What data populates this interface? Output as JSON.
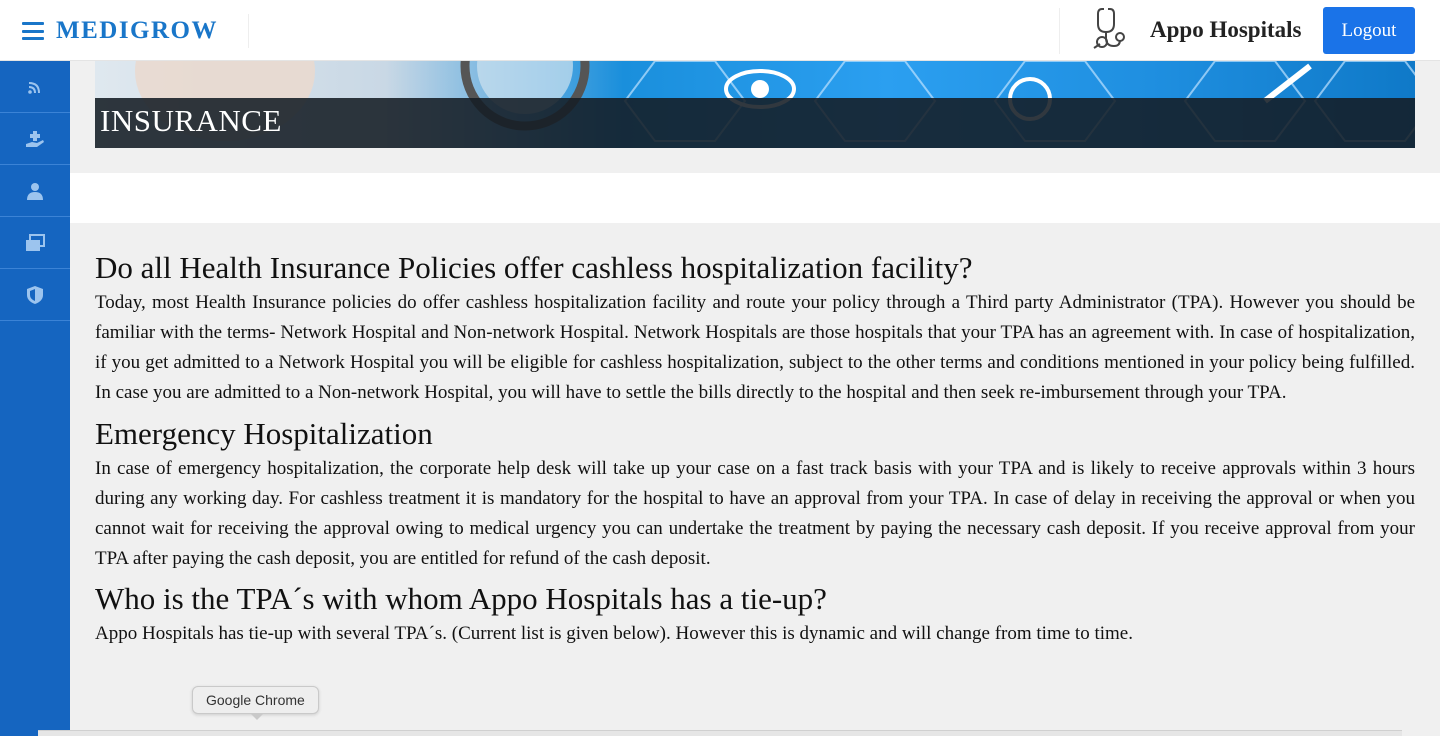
{
  "header": {
    "brand": "MEDIGROW",
    "hospital_name": "Appo Hospitals",
    "logout_label": "Logout"
  },
  "sidebar": {
    "items": [
      {
        "icon": "rss-feed-icon"
      },
      {
        "icon": "donate-hand-icon"
      },
      {
        "icon": "doctor-icon"
      },
      {
        "icon": "gallery-icon"
      },
      {
        "icon": "shield-icon"
      }
    ]
  },
  "banner": {
    "title": "INSURANCE"
  },
  "sections": [
    {
      "heading": "Do all Health Insurance Policies offer cashless hospitalization facility?",
      "body": "Today, most Health Insurance policies do offer cashless hospitalization facility and route your policy through a Third party Administrator (TPA). However you should be familiar with the terms- Network Hospital and Non-network Hospital. Network Hospitals are those hospitals that your TPA has an agreement with. In case of hospitalization, if you get admitted to a Network Hospital you will be eligible for cashless hospitalization, subject to the other terms and conditions mentioned in your policy being fulfilled. In case you are admitted to a Non-network Hospital, you will have to settle the bills directly to the hospital and then seek re-imbursement through your TPA."
    },
    {
      "heading": "Emergency Hospitalization",
      "body": "In case of emergency hospitalization, the corporate help desk will take up your case on a fast track basis with your TPA and is likely to receive approvals within 3 hours during any working day. For cashless treatment it is mandatory for the hospital to have an approval from your TPA. In case of delay in receiving the approval or when you cannot wait for receiving the approval owing to medical urgency you can undertake the treatment by paying the necessary cash deposit. If you receive approval from your TPA after paying the cash deposit, you are entitled for refund of the cash deposit."
    },
    {
      "heading": "Who is the TPA´s with whom Appo Hospitals has a tie-up?",
      "body": "Appo Hospitals has tie-up with several TPA´s. (Current list is given below). However this is dynamic and will change from time to time."
    }
  ],
  "tooltip": {
    "text": "Google Chrome"
  },
  "colors": {
    "brand_blue": "#1976c9",
    "sidebar_blue": "#1565c0",
    "logout_blue": "#1a73e8"
  }
}
